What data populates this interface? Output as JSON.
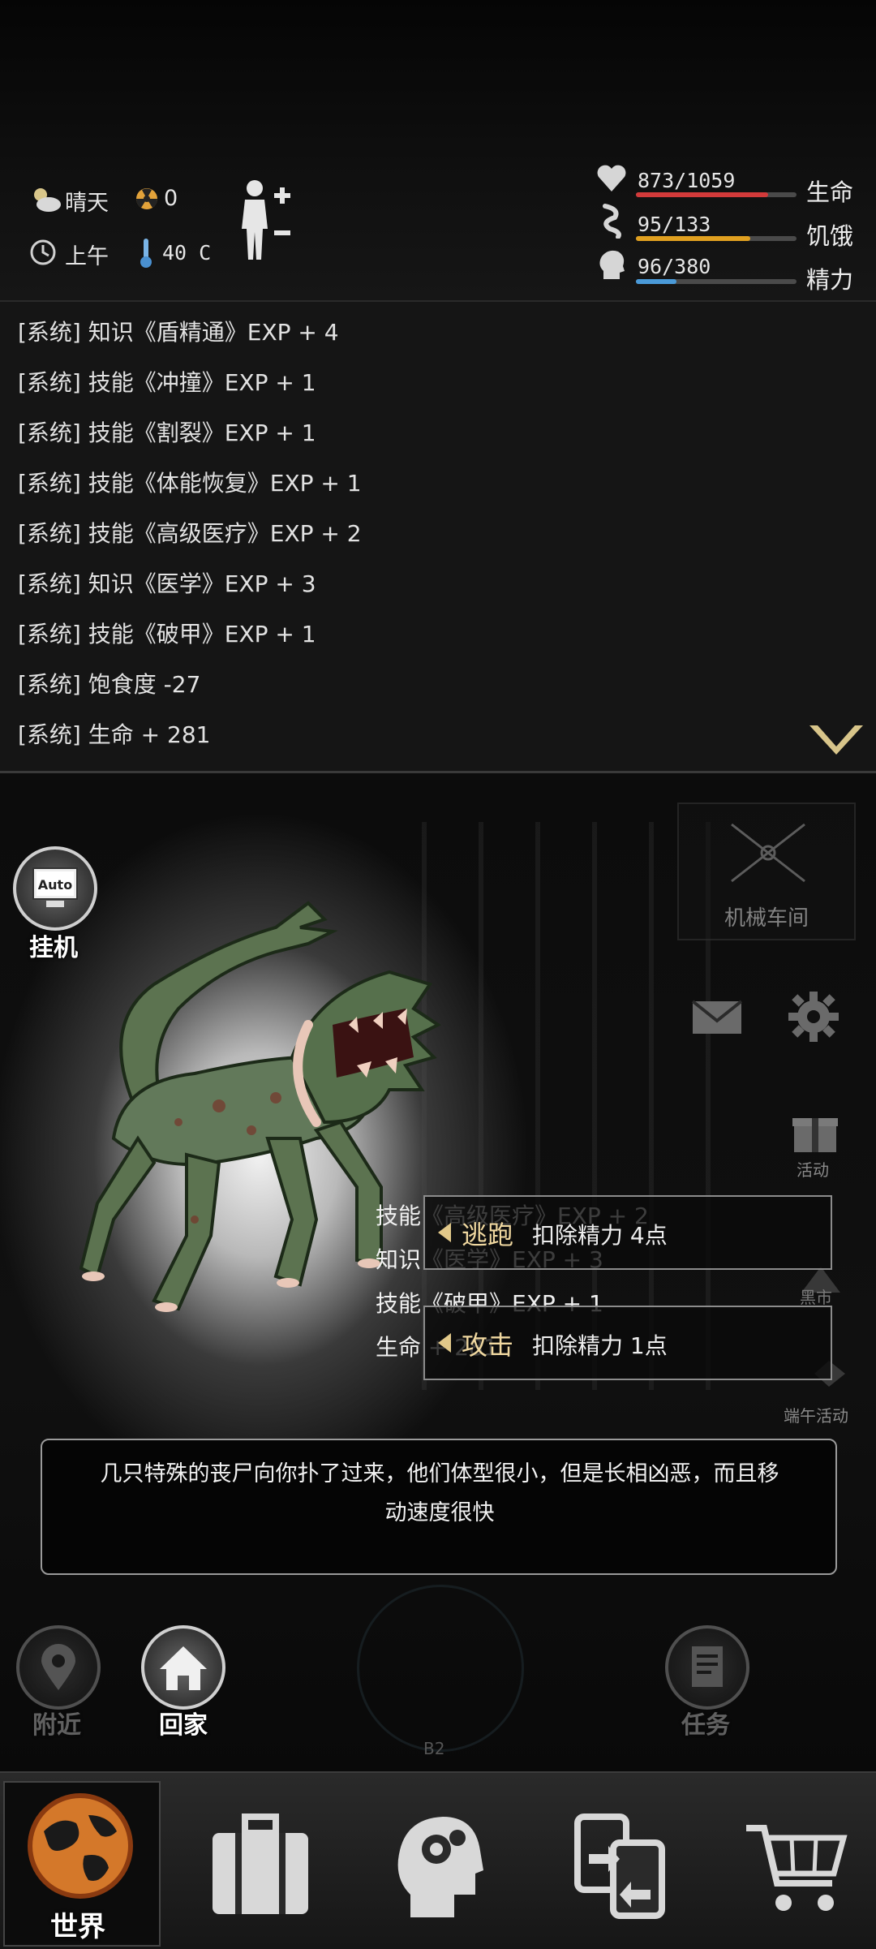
{
  "status": {
    "weather": "晴天",
    "radiation": "0",
    "time_of_day": "上午",
    "temperature": "40 C"
  },
  "vitals": [
    {
      "label": "生命",
      "value": "873/1059",
      "fraction": 0.824,
      "color": "#d23a3a"
    },
    {
      "label": "饥饿",
      "value": "95/133",
      "fraction": 0.714,
      "color": "#e0a020"
    },
    {
      "label": "精力",
      "value": "96/380",
      "fraction": 0.253,
      "color": "#4a9ad8"
    }
  ],
  "log": [
    "[系统] 知识《盾精通》EXP + 4",
    "[系统] 技能《冲撞》EXP + 1",
    "[系统] 技能《割裂》EXP + 1",
    "[系统] 技能《体能恢复》EXP + 1",
    "[系统] 技能《高级医疗》EXP + 2",
    "[系统] 知识《医学》EXP + 3",
    "[系统] 技能《破甲》EXP + 1",
    "[系统] 饱食度 -27",
    "[系统] 生命 + 281"
  ],
  "scene": {
    "auto_label": "Auto",
    "auto_caption": "挂机",
    "location_label": "机械车间",
    "event_label": "活动",
    "market_label": "黑市",
    "festival_label": "端午活动",
    "mini_log": [
      "技能《高级医疗》EXP + 2",
      "知识《医学》EXP + 3",
      "技能《破甲》EXP + 1",
      "生命 + 281"
    ],
    "actions": [
      {
        "name": "逃跑",
        "desc": "扣除精力 4点"
      },
      {
        "name": "攻击",
        "desc": "扣除精力 1点"
      }
    ],
    "message": "几只特殊的丧尸向你扑了过来，他们体型很小，但是长相凶恶，而且移动速度很快",
    "nearby_label": "附近",
    "home_label": "回家",
    "task_label": "任务",
    "map_floor": "B2"
  },
  "nav": {
    "world_label": "世界",
    "icons": [
      "globe-icon",
      "suitcase-icon",
      "brain-head-icon",
      "swap-cards-icon",
      "cart-icon"
    ]
  }
}
